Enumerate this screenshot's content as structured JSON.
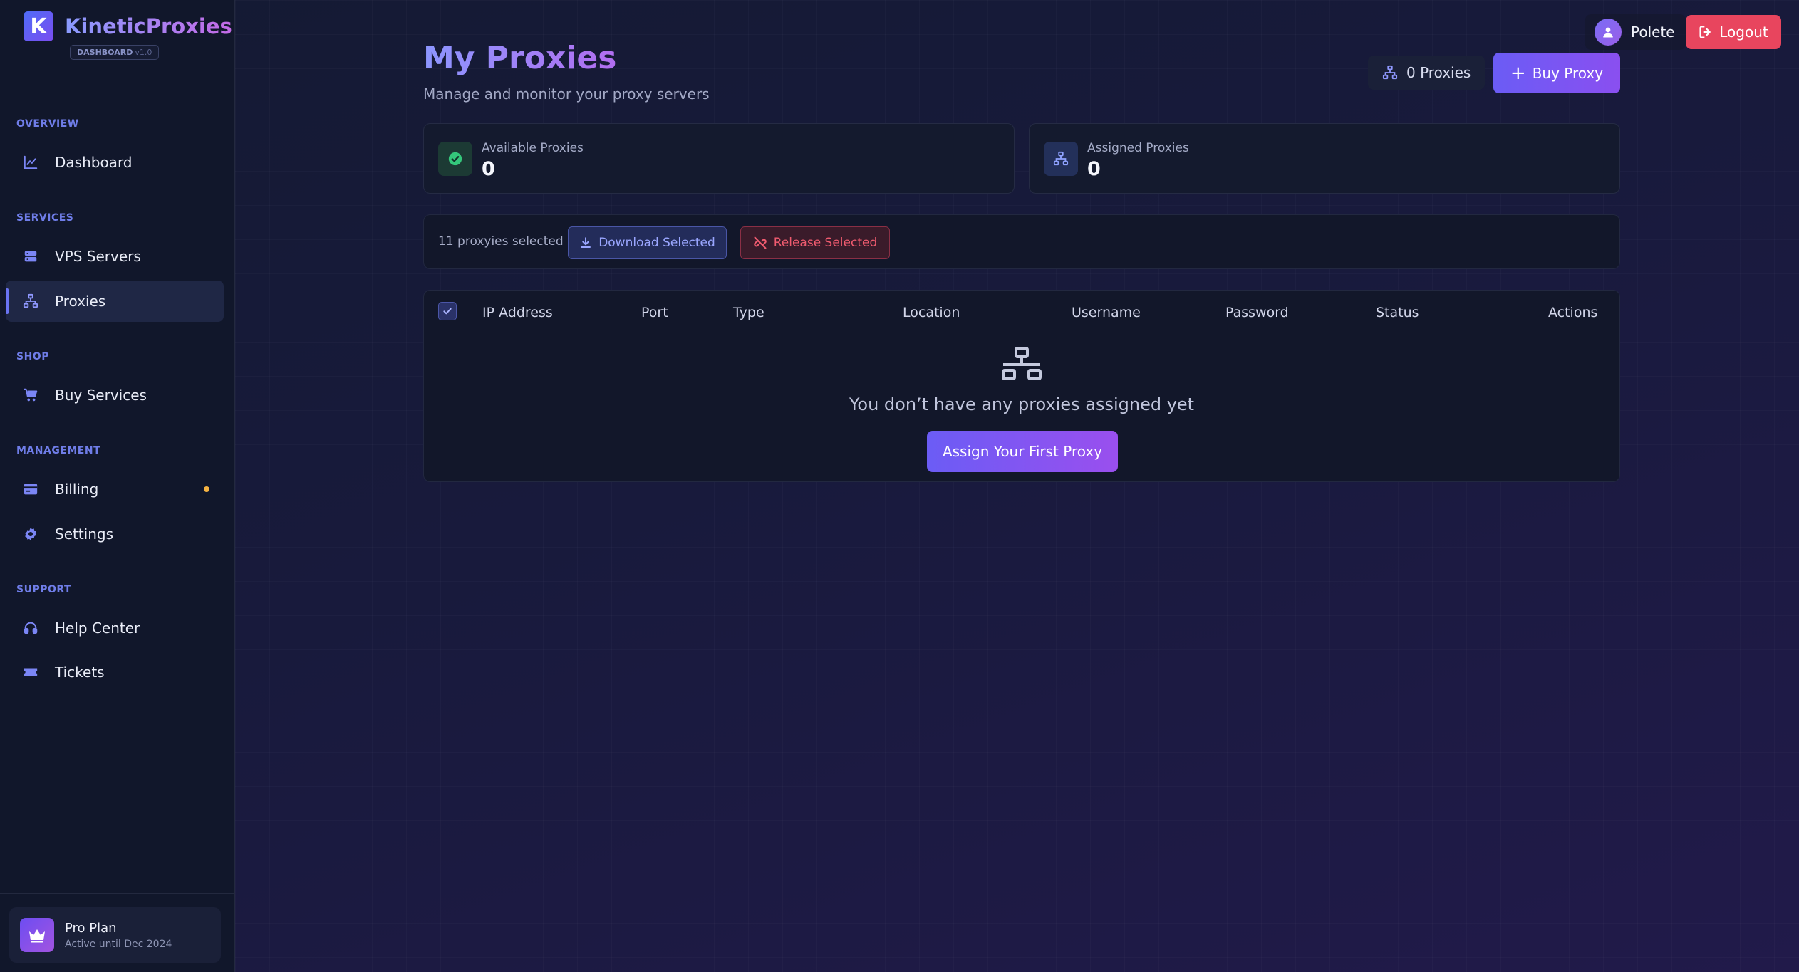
{
  "brand": {
    "logo_letter": "K",
    "name": "KineticProxies",
    "badge": "DASHBOARD",
    "version": "v1.0"
  },
  "sidebar": {
    "sections": [
      {
        "label": "OVERVIEW"
      },
      {
        "label": "SERVICES"
      },
      {
        "label": "SHOP"
      },
      {
        "label": "MANAGEMENT"
      },
      {
        "label": "SUPPORT"
      }
    ],
    "items": [
      {
        "label": "Dashboard",
        "icon": "chart-line-icon"
      },
      {
        "label": "VPS Servers",
        "icon": "server-icon"
      },
      {
        "label": "Proxies",
        "icon": "network-icon",
        "active": true
      },
      {
        "label": "Buy Services",
        "icon": "cart-icon"
      },
      {
        "label": "Billing",
        "icon": "credit-card-icon",
        "has_notification_dot": true
      },
      {
        "label": "Settings",
        "icon": "gear-icon"
      },
      {
        "label": "Help Center",
        "icon": "headset-icon"
      },
      {
        "label": "Tickets",
        "icon": "ticket-icon"
      }
    ],
    "plan": {
      "title": "Pro Plan",
      "subtitle": "Active until Dec 2024",
      "icon": "crown-icon"
    }
  },
  "header": {
    "user_name": "Polete",
    "logout_label": "Logout"
  },
  "main": {
    "title": "My Proxies",
    "subtitle": "Manage and monitor your proxy servers",
    "proxy_count_label": "0 Proxies",
    "buy_label": "Buy Proxy",
    "stats": [
      {
        "label": "Available Proxies",
        "value": "0",
        "icon": "check-circle-icon"
      },
      {
        "label": "Assigned Proxies",
        "value": "0",
        "icon": "network-icon"
      }
    ],
    "bulk": {
      "selected_text": "11 proxyies selected",
      "download_label": "Download Selected",
      "release_label": "Release Selected"
    },
    "table": {
      "columns": [
        "IP Address",
        "Port",
        "Type",
        "Location",
        "Username",
        "Password",
        "Status",
        "Actions"
      ],
      "select_all_checked": true,
      "empty_text": "You don’t have any proxies assigned yet",
      "empty_button": "Assign Your First Proxy"
    }
  },
  "colors": {
    "accent": "#6b5cf5",
    "danger": "#e8455e",
    "success": "#34c77b",
    "sidebar_bg": "#11172b"
  }
}
